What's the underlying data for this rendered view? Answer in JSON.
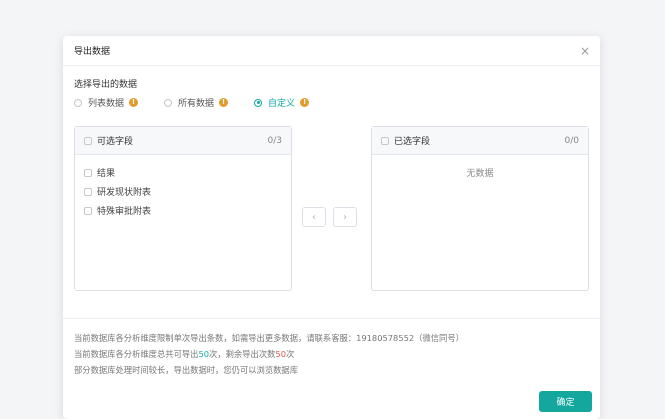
{
  "dialog": {
    "title": "导出数据",
    "close_icon": "×",
    "section_label": "选择导出的数据",
    "radio_options": [
      {
        "label": "列表数据",
        "selected": false
      },
      {
        "label": "所有数据",
        "selected": false
      },
      {
        "label": "自定义",
        "selected": true
      }
    ],
    "info_glyph": "!",
    "available_panel": {
      "title": "可选字段",
      "count": "0/3",
      "items": [
        "结果",
        "研发现状附表",
        "特殊审批附表"
      ]
    },
    "selected_panel": {
      "title": "已选字段",
      "count": "0/0",
      "empty_text": "无数据"
    },
    "arrows": {
      "left": "‹",
      "right": "›"
    },
    "notes": {
      "line1": "当前数据库各分析维度限制单次导出条数，如需导出更多数据，请联系客服：19180578552（微信同号）",
      "line2_prefix": "当前数据库各分析维度总共可导出",
      "line2_total": "50",
      "line2_mid": "次，剩余导出次数",
      "line2_remaining": "50",
      "line2_suffix": "次",
      "line3": "部分数据库处理时间较长，导出数据时，您仍可以浏览数据库"
    },
    "confirm_label": "确定"
  },
  "colors": {
    "accent": "#12a9a1",
    "warning_icon": "#e29c2b",
    "remaining": "#e5544a"
  }
}
